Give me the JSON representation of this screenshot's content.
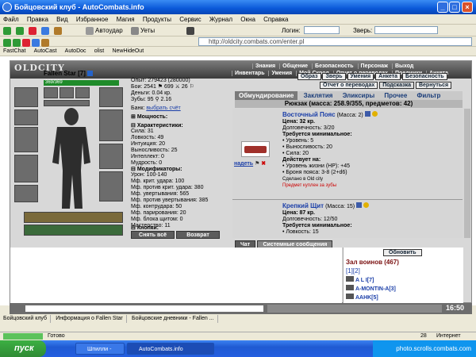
{
  "window": {
    "title": "Бойцовский клуб - AutoCombats.info"
  },
  "menu": [
    "Файл",
    "Правка",
    "Вид",
    "Избранное",
    "Магия",
    "Продукты",
    "Сервис",
    "Журнал",
    "Окна",
    "Справка"
  ],
  "toolbar": {
    "autoudar": "Автоудар",
    "utyoty": "Уеты",
    "login_label": "Логин:",
    "zver_label": "Зверь:"
  },
  "address": {
    "url": "http://oldcity.combats.com/enter.pl"
  },
  "links": [
    "FastChat",
    "AutoCast",
    "AutoDoc",
    "olist",
    "NewHideOut"
  ],
  "game": {
    "logo": "OLDCITY",
    "nav_top": [
      "Знания",
      "Общение",
      "Безопасность",
      "Персонаж",
      "Выход"
    ],
    "nav_bottom": [
      "Инвентарь",
      "Умения",
      "Мой Скрол",
      "Отчет о переводах",
      "Поединки",
      "Анкета"
    ],
    "char_buttons": [
      "Образ",
      "Зверь",
      "Умения",
      "Анкета",
      "Безопасность"
    ],
    "char_buttons2": [
      "Отчет о переводах",
      "Подсказка",
      "Вернуться"
    ]
  },
  "character": {
    "name": "Fallen Star",
    "level": "[7]",
    "hp": "369/369",
    "stats_top": [
      "Опыт: 279423 (280000)",
      "Бои: 2541 ⚑ 699 ⚔ 26 ⚐",
      "Деньги: 0.04 кр.",
      "Зубы: 95 ⚲ 2.16"
    ],
    "bank": "Банк:",
    "bank_link": "выбрать счёт",
    "power": "Мощность:",
    "characteristics": "Характеристики:",
    "chars": [
      "Сила: 31",
      "Ловкость: 49",
      "Интуиция: 20",
      "Выносливость: 25",
      "Интеллект: 0",
      "Мудрость: 0"
    ],
    "modifiers": "Модификаторы:",
    "mods": [
      "Урон: 100-140",
      "Мф. крит. удара: 100",
      "Мф. против крит. удара: 380",
      "Мф. увертывания: 565",
      "Мф. против увертывания: 385",
      "Мф. контрудара: 50",
      "Мф. парирования: 20",
      "Мф. блока щитом: 0",
      "Мастерство: 11"
    ],
    "buttons_label": "Кнопки:",
    "remove_all": "Снять всё",
    "return": "Возврат"
  },
  "tabs": [
    "Обмундирование",
    "Заклятия",
    "Эликсиры",
    "Прочее",
    "Фильтр"
  ],
  "backpack": "Рюкзак (масса: 258.9/355, предметов: 42)",
  "items": [
    {
      "name": "Восточный Пояс",
      "mass": "(Масса: 2)",
      "price": "Цена: 32 кр.",
      "durability": "Долговечность: 3/20",
      "req_title": "Требуется минимальное:",
      "reqs": [
        "• Уровень: 5",
        "• Выносливость: 20",
        "• Сила: 20"
      ],
      "acts_title": "Действует на:",
      "acts": [
        "• Уровень жизни (HP): +45",
        "• Броня пояса: 3-8 (2+d6)"
      ],
      "made": "Сделано в Old city",
      "bought": "Предмет куплен за зубы",
      "wear": "надеть"
    },
    {
      "name": "Крепкий Щит",
      "mass": "(Масса: 15)",
      "price": "Цена: 87 кр.",
      "durability": "Долговечность: 12/50",
      "req_title": "Требуется минимальное:",
      "reqs": [
        "• Ловкость: 15"
      ]
    }
  ],
  "chat": {
    "tab1": "Чат",
    "tab2": "Системные сообщения"
  },
  "room": {
    "refresh": "Обновить",
    "title": "Зал воинов (467)",
    "pages": "[1][2]",
    "players": [
      "A L I[7]",
      "A-MONTIN-A[3]",
      "AAHK[5]"
    ]
  },
  "clock": "16:50",
  "sitelinks": [
    "Бойцовский клуб",
    "Информация о Fallen Star",
    "Бойцовские дневники - Fallen ..."
  ],
  "status": {
    "ready": "Готово",
    "count": "28",
    "zone": "Интернет"
  },
  "taskbar": {
    "start": "пуск",
    "task1": "Шпилли - ГАррн Пот...",
    "task2": "AutoCombats.info",
    "watermark": "photo.scrolls.combats.com"
  },
  "colors": {
    "xp_blue": "#0a58d8",
    "hp_green": "#1f8b2a",
    "link_blue": "#1a3ea8",
    "red": "#cc0000"
  }
}
